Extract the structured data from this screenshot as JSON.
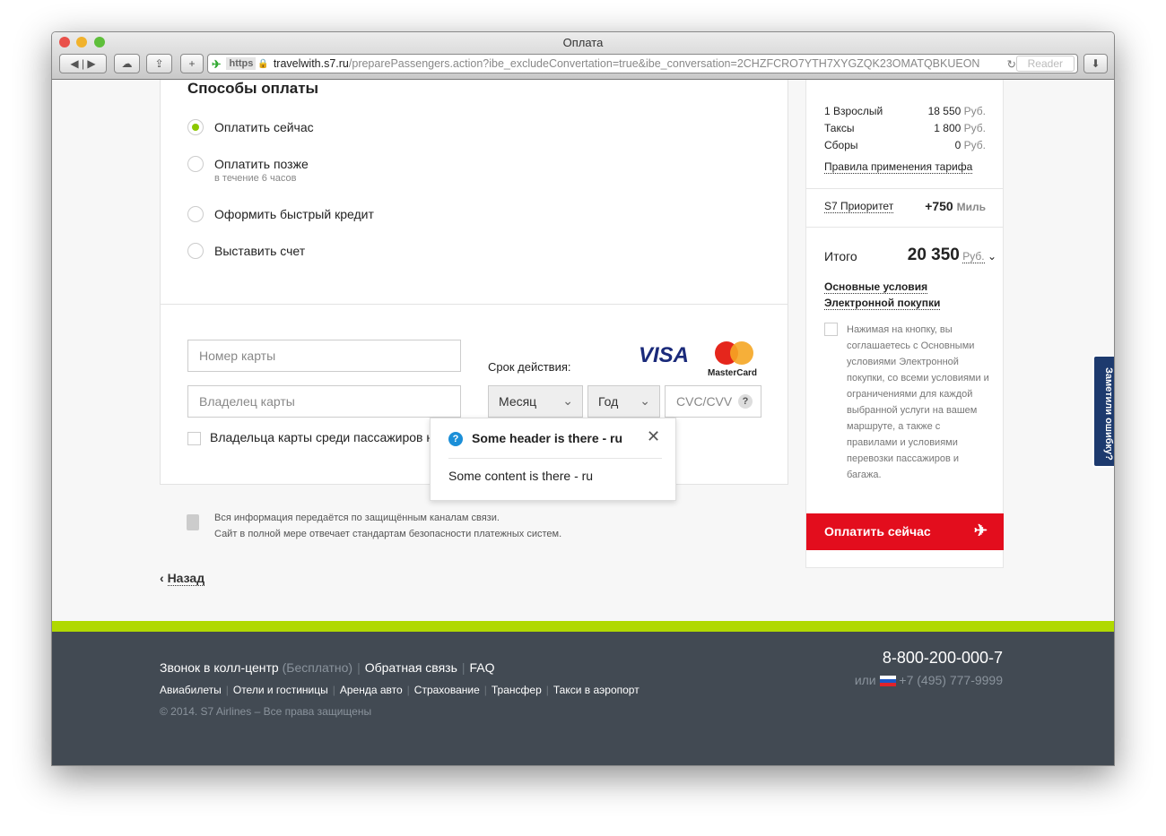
{
  "browser": {
    "title": "Оплата",
    "https": "https",
    "domain": "travelwith.s7.ru",
    "path": "/preparePassengers.action?ibe_excludeConvertation=true&ibe_conversation=2CHZFCRO7YTH7XYGZQK23OMATQBKUEON",
    "reader": "Reader"
  },
  "payment": {
    "heading": "Способы оплаты",
    "options": [
      {
        "label": "Оплатить сейчас",
        "selected": true
      },
      {
        "label": "Оплатить позже",
        "sub": "в течение 6 часов",
        "selected": false
      },
      {
        "label": "Оформить быстрый кредит",
        "selected": false
      },
      {
        "label": "Выставить счет",
        "selected": false
      }
    ]
  },
  "card": {
    "number_placeholder": "Номер карты",
    "holder_placeholder": "Владелец карты",
    "expiry_label": "Срок действия:",
    "month": "Месяц",
    "year": "Год",
    "cvc": "CVC/CVV",
    "cvc_help": "?",
    "visa": "VISA",
    "mastercard": "MasterCard",
    "holder_checkbox": "Владельца карты среди пассажиров н"
  },
  "popover": {
    "header": "Some header is there - ru",
    "content": "Some content is there - ru"
  },
  "security": {
    "line1": "Вся информация передаётся по защищённым каналам связи.",
    "line2": "Сайт в полной мере отвечает стандартам безопасности платежных систем."
  },
  "back": "Назад",
  "summary": {
    "rows": [
      {
        "label": "1 Взрослый",
        "amount": "18 550",
        "cur": "Руб."
      },
      {
        "label": "Таксы",
        "amount": "1 800",
        "cur": "Руб."
      },
      {
        "label": "Сборы",
        "amount": "0",
        "cur": "Руб."
      }
    ],
    "rules_link": "Правила применения тарифа",
    "priority": "S7 Приоритет",
    "miles": "+750",
    "miles_unit": "Миль",
    "total_label": "Итого",
    "total": "20 350",
    "total_cur": "Руб.",
    "terms_link1": "Основные условия",
    "terms_link2": "Электронной покупки",
    "agree_text": "Нажимая на кнопку, вы соглашаетесь с Основными условиями Электронной покупки, со всеми условиями и ограничениями для каждой выбранной услуги на вашем маршруте, а также с правилами и условиями перевозки пассажиров и багажа.",
    "pay_button": "Оплатить сейчас"
  },
  "feedback_tab": "Заметили ошибку?",
  "footer": {
    "call": "Звонок в колл-центр",
    "call_free": "(Бесплатно)",
    "feedback": "Обратная связь",
    "faq": "FAQ",
    "links": [
      "Авиабилеты",
      "Отели и гостиницы",
      "Аренда авто",
      "Страхование",
      "Трансфер",
      "Такси в аэропорт"
    ],
    "copyright": "© 2014. S7 Airlines – Все права защищены",
    "phone": "8-800-200-000-7",
    "or": "или",
    "phone2": "+7 (495) 777-9999"
  },
  "colors": {
    "accent": "#8cc800",
    "pay": "#e30d1d",
    "footer": "#424a53",
    "stripe": "#b0d900"
  }
}
